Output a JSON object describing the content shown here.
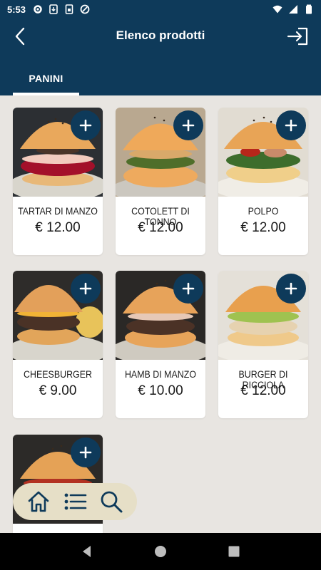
{
  "status": {
    "time": "5:53"
  },
  "header": {
    "title": "Elenco prodotti"
  },
  "tabs": [
    {
      "label": "PANINI",
      "active": true
    }
  ],
  "colors": {
    "primary": "#0e3a5a",
    "background": "#e8e5e1",
    "nav_pill": "#e6dfc7"
  },
  "products": [
    {
      "name": "TARTAR DI MANZO",
      "price": "€ 12.00"
    },
    {
      "name": "COTOLETT DI TONNO",
      "price": "€ 12.00"
    },
    {
      "name": "POLPO",
      "price": "€ 12.00"
    },
    {
      "name": "CHEESBURGER",
      "price": "€ 9.00"
    },
    {
      "name": "HAMB DI MANZO",
      "price": "€ 10.00"
    },
    {
      "name": "BURGER DI RICCIOLA",
      "price": "€ 12.00"
    },
    {
      "name": "",
      "price": ""
    }
  ],
  "bottom_nav": {
    "icons": [
      "home-icon",
      "list-icon",
      "search-icon"
    ]
  }
}
